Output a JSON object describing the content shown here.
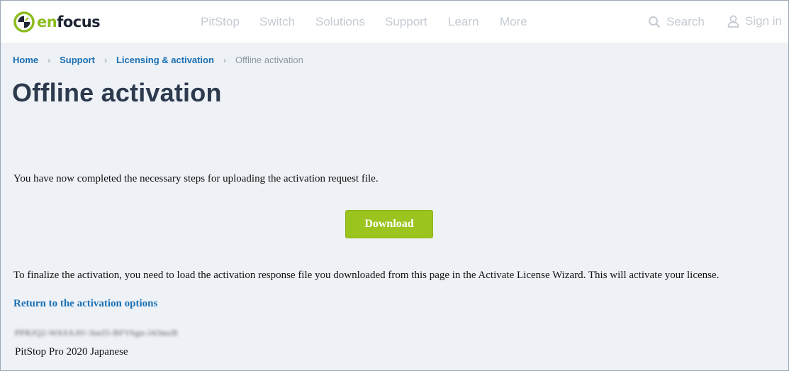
{
  "header": {
    "logo": {
      "en": "en",
      "focus": "focus"
    },
    "nav": [
      "PitStop",
      "Switch",
      "Solutions",
      "Support",
      "Learn",
      "More"
    ],
    "search_label": "Search",
    "signin_label": "Sign in"
  },
  "breadcrumb": {
    "items": [
      "Home",
      "Support",
      "Licensing & activation"
    ],
    "current": "Offline activation"
  },
  "page": {
    "title": "Offline activation",
    "intro_text": "You have now completed the necessary steps for uploading the activation request file.",
    "download_label": "Download",
    "finalize_text": "To finalize the activation, you need to load the activation response file you downloaded from this page in the Activate License Wizard. This will activate your license.",
    "return_link": "Return to the activation options",
    "license_key": "PPRJQ2-WASAAV-3neI5-BFVbgn-J43mzB",
    "product_name": "PitStop Pro 2020 Japanese"
  },
  "colors": {
    "brand_green": "#9bc41f",
    "link_blue": "#1a6fb3",
    "title": "#2d3a4e",
    "background": "#eef2f6"
  }
}
